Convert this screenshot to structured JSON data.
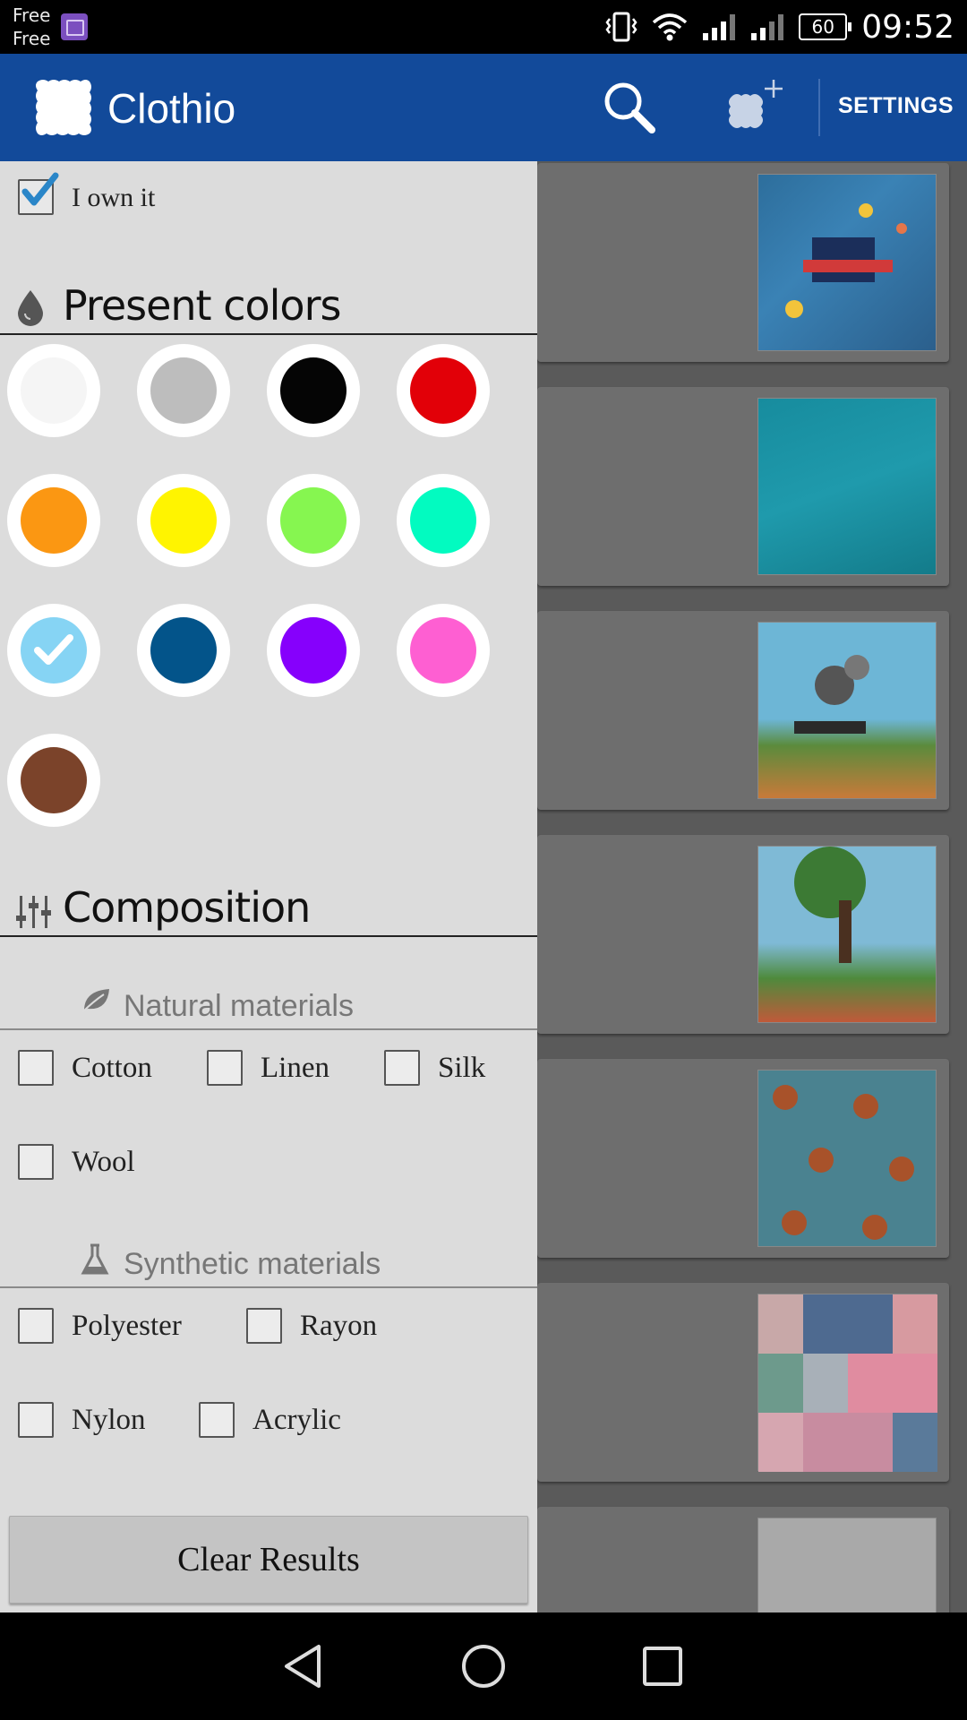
{
  "status_bar": {
    "carrier_line1": "Free",
    "carrier_line2": "Free",
    "battery": "60",
    "time": "09:52"
  },
  "app_bar": {
    "title": "Clothio",
    "settings_label": "SETTINGS"
  },
  "filters": {
    "own_it_label": "I own it",
    "own_it_checked": true,
    "colors_title": "Present colors",
    "colors": [
      {
        "name": "white",
        "hex": "#f5f5f5",
        "selected": false
      },
      {
        "name": "grey",
        "hex": "#bdbdbd",
        "selected": false
      },
      {
        "name": "black",
        "hex": "#050505",
        "selected": false
      },
      {
        "name": "red",
        "hex": "#e20008",
        "selected": false
      },
      {
        "name": "orange",
        "hex": "#fb9712",
        "selected": false
      },
      {
        "name": "yellow",
        "hex": "#fff400",
        "selected": false
      },
      {
        "name": "green",
        "hex": "#86f650",
        "selected": false
      },
      {
        "name": "turquoise",
        "hex": "#02fbc0",
        "selected": false
      },
      {
        "name": "light-blue",
        "hex": "#86d4f4",
        "selected": true
      },
      {
        "name": "dark-blue",
        "hex": "#03548a",
        "selected": false
      },
      {
        "name": "purple",
        "hex": "#8600fc",
        "selected": false
      },
      {
        "name": "pink",
        "hex": "#fe5fd2",
        "selected": false
      },
      {
        "name": "brown",
        "hex": "#7b432a",
        "selected": false
      }
    ],
    "composition_title": "Composition",
    "natural_title": "Natural materials",
    "natural": [
      "Cotton",
      "Linen",
      "Silk",
      "Wool"
    ],
    "synthetic_title": "Synthetic materials",
    "synthetic": [
      "Polyester",
      "Rayon",
      "Nylon",
      "Acrylic"
    ],
    "clear_label": "Clear Results"
  },
  "fabric_list": [
    {
      "color": "#2d6e9c"
    },
    {
      "color": "#1f8b9c"
    },
    {
      "color": "#4b7d8e"
    },
    {
      "color": "#4f6a4c"
    },
    {
      "color": "#3e7a86"
    },
    {
      "color": "#a5a090"
    },
    {
      "color": "#a7a7a7"
    }
  ]
}
